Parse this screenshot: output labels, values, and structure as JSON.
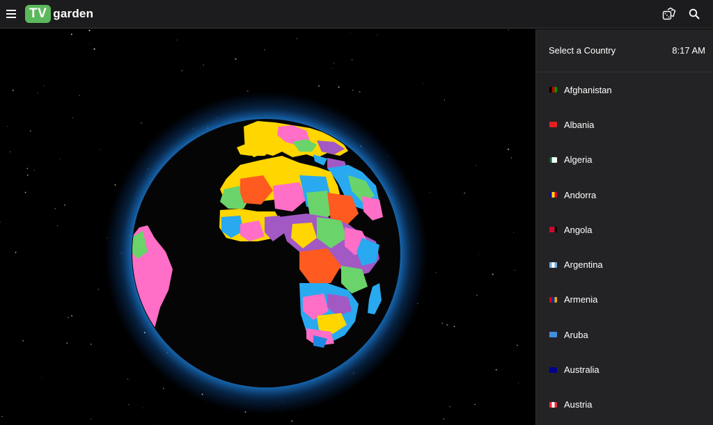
{
  "header": {
    "logo_badge": "TV",
    "logo_text": "garden",
    "icons": [
      "menu-icon",
      "dice-icon",
      "search-icon"
    ]
  },
  "panel": {
    "title": "Select a Country",
    "time": "8:17 AM",
    "countries": [
      {
        "name": "Afghanistan",
        "flag": [
          "#000000",
          "#bf0000",
          "#009900"
        ]
      },
      {
        "name": "Albania",
        "flag": [
          "#e41e20",
          "#e41e20",
          "#e41e20"
        ]
      },
      {
        "name": "Algeria",
        "flag": [
          "#006233",
          "#ffffff",
          "#ffffff"
        ]
      },
      {
        "name": "Andorra",
        "flag": [
          "#10069f",
          "#fedd00",
          "#d50032"
        ]
      },
      {
        "name": "Angola",
        "flag": [
          "#cc092f",
          "#cc092f",
          "#000000"
        ]
      },
      {
        "name": "Argentina",
        "flag": [
          "#74acdf",
          "#ffffff",
          "#74acdf"
        ]
      },
      {
        "name": "Armenia",
        "flag": [
          "#d90012",
          "#0033a0",
          "#f2a800"
        ]
      },
      {
        "name": "Aruba",
        "flag": [
          "#418fde",
          "#418fde",
          "#418fde"
        ]
      },
      {
        "name": "Australia",
        "flag": [
          "#00008b",
          "#00008b",
          "#00008b"
        ]
      },
      {
        "name": "Austria",
        "flag": [
          "#ed2939",
          "#ffffff",
          "#ed2939"
        ]
      }
    ]
  },
  "colors": {
    "accent": "#5cb85c",
    "topbar": "#1c1c1e",
    "panel": "#232325",
    "globe_glow": "#1e88e5"
  }
}
